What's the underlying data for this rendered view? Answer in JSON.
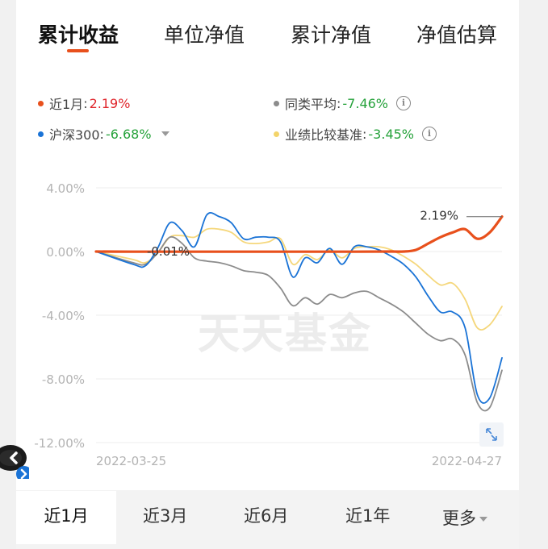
{
  "tabs": [
    {
      "label": "累计收益",
      "active": true
    },
    {
      "label": "单位净值",
      "active": false
    },
    {
      "label": "累计净值",
      "active": false
    },
    {
      "label": "净值估算",
      "active": false
    }
  ],
  "legend": [
    {
      "label": "近1月",
      "value": "2.19%",
      "color": "#e8501c",
      "value_color": "#e0262c"
    },
    {
      "label": "同类平均",
      "value": "-7.46%",
      "color": "#8c8c8c",
      "value_color": "#26a23b"
    },
    {
      "label": "沪深300",
      "value": "-6.68%",
      "color": "#1a73d6",
      "value_color": "#26a23b"
    },
    {
      "label": "业绩比较基准",
      "value": "-3.45%",
      "color": "#f3d46a",
      "value_color": "#26a23b"
    }
  ],
  "watermark": "天天基金",
  "range_tabs": [
    {
      "label": "近1月",
      "active": true
    },
    {
      "label": "近3月",
      "active": false
    },
    {
      "label": "近6月",
      "active": false
    },
    {
      "label": "近1年",
      "active": false
    },
    {
      "label": "更多",
      "active": false
    }
  ],
  "icons": {
    "info": "info-icon",
    "dropdown": "caret-down-icon",
    "expand": "expand-icon",
    "assistant": "robot-icon"
  },
  "chart_data": {
    "type": "line",
    "x_range": [
      "2022-03-25",
      "2022-04-27"
    ],
    "x_labels": [
      "2022-03-25",
      "2022-04-27"
    ],
    "y_ticks": [
      "4.00%",
      "0.00%",
      "-4.00%",
      "-8.00%",
      "-12.00%"
    ],
    "ylim": [
      -12,
      4
    ],
    "grid": true,
    "annotations": [
      {
        "text": "-0.01%",
        "x": "2022-03-29",
        "y": -0.01
      },
      {
        "text": "2.19%",
        "x": "2022-04-27",
        "y": 2.19
      }
    ],
    "series": [
      {
        "name": "业绩比较基准",
        "color": "#f5d77b",
        "points": [
          [
            "2022-03-25",
            0
          ],
          [
            "2022-03-28",
            -0.5
          ],
          [
            "2022-03-29",
            -0.7
          ],
          [
            "2022-03-30",
            -0.1
          ],
          [
            "2022-03-31",
            0.9
          ],
          [
            "2022-04-01",
            1.0
          ],
          [
            "2022-04-02",
            0.9
          ],
          [
            "2022-04-03",
            1.4
          ],
          [
            "2022-04-04",
            1.4
          ],
          [
            "2022-04-05",
            1.2
          ],
          [
            "2022-04-06",
            0.6
          ],
          [
            "2022-04-07",
            0.5
          ],
          [
            "2022-04-08",
            0.6
          ],
          [
            "2022-04-09",
            0.8
          ],
          [
            "2022-04-10",
            -0.8
          ],
          [
            "2022-04-11",
            -0.2
          ],
          [
            "2022-04-12",
            -0.5
          ],
          [
            "2022-04-13",
            0.1
          ],
          [
            "2022-04-14",
            -0.4
          ],
          [
            "2022-04-15",
            0.2
          ],
          [
            "2022-04-16",
            0.3
          ],
          [
            "2022-04-17",
            0.3
          ],
          [
            "2022-04-18",
            0.1
          ],
          [
            "2022-04-19",
            -0.3
          ],
          [
            "2022-04-20",
            -0.8
          ],
          [
            "2022-04-21",
            -1.5
          ],
          [
            "2022-04-22",
            -2.1
          ],
          [
            "2022-04-23",
            -2.0
          ],
          [
            "2022-04-24",
            -3.0
          ],
          [
            "2022-04-25",
            -4.8
          ],
          [
            "2022-04-26",
            -4.6
          ],
          [
            "2022-04-27",
            -3.45
          ]
        ]
      },
      {
        "name": "同类平均",
        "color": "#8c8c8c",
        "points": [
          [
            "2022-03-25",
            0
          ],
          [
            "2022-03-28",
            -0.7
          ],
          [
            "2022-03-29",
            -0.8
          ],
          [
            "2022-03-30",
            -0.1
          ],
          [
            "2022-03-31",
            0.9
          ],
          [
            "2022-04-01",
            0.5
          ],
          [
            "2022-04-02",
            -0.4
          ],
          [
            "2022-04-03",
            -0.6
          ],
          [
            "2022-04-04",
            -0.7
          ],
          [
            "2022-04-05",
            -0.9
          ],
          [
            "2022-04-06",
            -1.2
          ],
          [
            "2022-04-07",
            -1.3
          ],
          [
            "2022-04-08",
            -1.5
          ],
          [
            "2022-04-09",
            -2.3
          ],
          [
            "2022-04-10",
            -3.4
          ],
          [
            "2022-04-11",
            -2.9
          ],
          [
            "2022-04-12",
            -3.3
          ],
          [
            "2022-04-13",
            -2.7
          ],
          [
            "2022-04-14",
            -2.9
          ],
          [
            "2022-04-15",
            -2.6
          ],
          [
            "2022-04-16",
            -2.5
          ],
          [
            "2022-04-17",
            -2.9
          ],
          [
            "2022-04-18",
            -3.3
          ],
          [
            "2022-04-19",
            -3.8
          ],
          [
            "2022-04-20",
            -4.5
          ],
          [
            "2022-04-21",
            -5.2
          ],
          [
            "2022-04-22",
            -5.6
          ],
          [
            "2022-04-23",
            -5.5
          ],
          [
            "2022-04-24",
            -6.5
          ],
          [
            "2022-04-25",
            -9.5
          ],
          [
            "2022-04-26",
            -9.8
          ],
          [
            "2022-04-27",
            -7.46
          ]
        ]
      },
      {
        "name": "沪深300",
        "color": "#1a73d6",
        "points": [
          [
            "2022-03-25",
            0
          ],
          [
            "2022-03-28",
            -0.8
          ],
          [
            "2022-03-29",
            -0.9
          ],
          [
            "2022-03-30",
            0.2
          ],
          [
            "2022-03-31",
            1.8
          ],
          [
            "2022-04-01",
            1.3
          ],
          [
            "2022-04-02",
            0.3
          ],
          [
            "2022-04-03",
            2.3
          ],
          [
            "2022-04-04",
            2.2
          ],
          [
            "2022-04-05",
            1.8
          ],
          [
            "2022-04-06",
            0.8
          ],
          [
            "2022-04-07",
            0.9
          ],
          [
            "2022-04-08",
            0.9
          ],
          [
            "2022-04-09",
            0.6
          ],
          [
            "2022-04-10",
            -1.6
          ],
          [
            "2022-04-11",
            -0.4
          ],
          [
            "2022-04-12",
            -0.7
          ],
          [
            "2022-04-13",
            0.2
          ],
          [
            "2022-04-14",
            -0.8
          ],
          [
            "2022-04-15",
            0.3
          ],
          [
            "2022-04-16",
            0.3
          ],
          [
            "2022-04-17",
            0.1
          ],
          [
            "2022-04-18",
            -0.3
          ],
          [
            "2022-04-19",
            -0.8
          ],
          [
            "2022-04-20",
            -1.6
          ],
          [
            "2022-04-21",
            -2.8
          ],
          [
            "2022-04-22",
            -3.8
          ],
          [
            "2022-04-23",
            -3.8
          ],
          [
            "2022-04-24",
            -4.8
          ],
          [
            "2022-04-25",
            -9.0
          ],
          [
            "2022-04-26",
            -9.2
          ],
          [
            "2022-04-27",
            -6.68
          ]
        ]
      },
      {
        "name": "近1月",
        "color": "#e8501c",
        "points": [
          [
            "2022-03-25",
            0
          ],
          [
            "2022-03-28",
            -0.01
          ],
          [
            "2022-03-29",
            -0.01
          ],
          [
            "2022-04-05",
            -0.01
          ],
          [
            "2022-04-10",
            -0.01
          ],
          [
            "2022-04-15",
            -0.01
          ],
          [
            "2022-04-18",
            0
          ],
          [
            "2022-04-19",
            0
          ],
          [
            "2022-04-20",
            0.1
          ],
          [
            "2022-04-21",
            0.5
          ],
          [
            "2022-04-22",
            0.9
          ],
          [
            "2022-04-23",
            1.2
          ],
          [
            "2022-04-24",
            1.4
          ],
          [
            "2022-04-25",
            0.8
          ],
          [
            "2022-04-26",
            1.2
          ],
          [
            "2022-04-27",
            2.19
          ]
        ]
      }
    ]
  }
}
